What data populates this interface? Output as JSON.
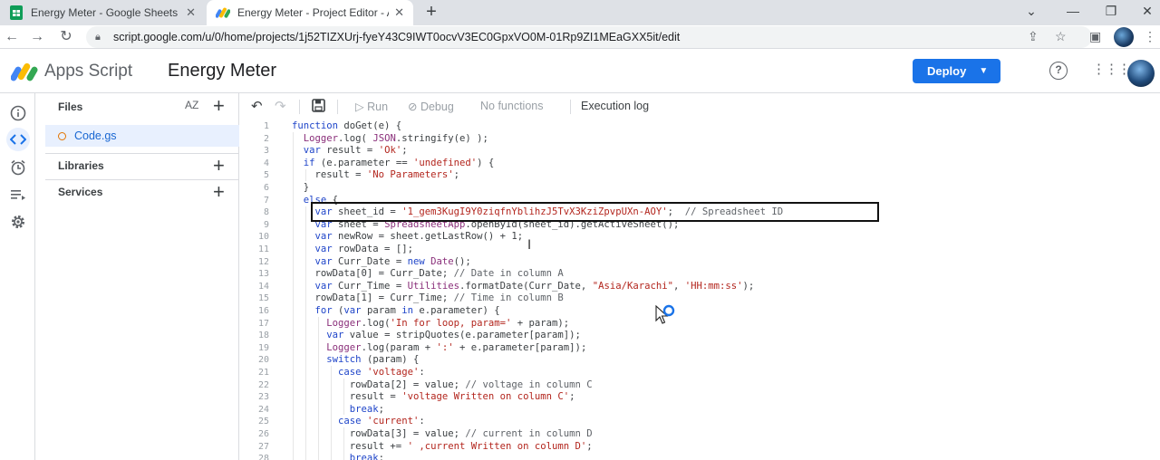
{
  "browser": {
    "tabs": [
      {
        "title": "Energy Meter - Google Sheets",
        "icon": "sheets-icon",
        "active": false
      },
      {
        "title": "Energy Meter - Project Editor - A",
        "icon": "apps-script-icon",
        "active": true
      }
    ],
    "url": "script.google.com/u/0/home/projects/1j52TIZXUrj-fyeY43C9IWT0ocvV3EC0GpxVO0M-01Rp9ZI1MEaGXX5it/edit"
  },
  "header": {
    "app_name": "Apps Script",
    "project_name": "Energy Meter",
    "deploy_label": "Deploy"
  },
  "files_panel": {
    "title": "Files",
    "sort_label": "AZ",
    "files": [
      "Code.gs"
    ],
    "libraries_label": "Libraries",
    "services_label": "Services"
  },
  "toolbar": {
    "run_label": "Run",
    "debug_label": "Debug",
    "function_select": "No functions",
    "execution_log_label": "Execution log"
  },
  "editor": {
    "line_numbers": [
      "1",
      "2",
      "3",
      "4",
      "5",
      "6",
      "7",
      "8",
      "9",
      "10",
      "11",
      "12",
      "13",
      "14",
      "15",
      "16",
      "17",
      "18",
      "19",
      "20",
      "21",
      "22",
      "23",
      "24",
      "25",
      "26",
      "27",
      "28"
    ],
    "lines": [
      "function doGet(e) {",
      "  Logger.log( JSON.stringify(e) );",
      "  var result = 'Ok';",
      "  if (e.parameter == 'undefined') {",
      "    result = 'No Parameters';",
      "  }",
      "  else {",
      "    var sheet_id = '1_gem3KugI9Y0ziqfnYblihzJ5TvX3KziZpvpUXn-AOY';  // Spreadsheet ID",
      "    var sheet = SpreadsheetApp.openById(sheet_id).getActiveSheet();",
      "    var newRow = sheet.getLastRow() + 1;",
      "    var rowData = [];",
      "    var Curr_Date = new Date();",
      "    rowData[0] = Curr_Date; // Date in column A",
      "    var Curr_Time = Utilities.formatDate(Curr_Date, \"Asia/Karachi\", 'HH:mm:ss');",
      "    rowData[1] = Curr_Time; // Time in column B",
      "    for (var param in e.parameter) {",
      "      Logger.log('In for loop, param=' + param);",
      "      var value = stripQuotes(e.parameter[param]);",
      "      Logger.log(param + ':' + e.parameter[param]);",
      "      switch (param) {",
      "        case 'voltage':",
      "          rowData[2] = value; // voltage in column C",
      "          result = 'voltage Written on column C';",
      "          break;",
      "        case 'current':",
      "          rowData[3] = value; // current in column D",
      "          result += ' ,current Written on column D';",
      "          break;"
    ]
  }
}
